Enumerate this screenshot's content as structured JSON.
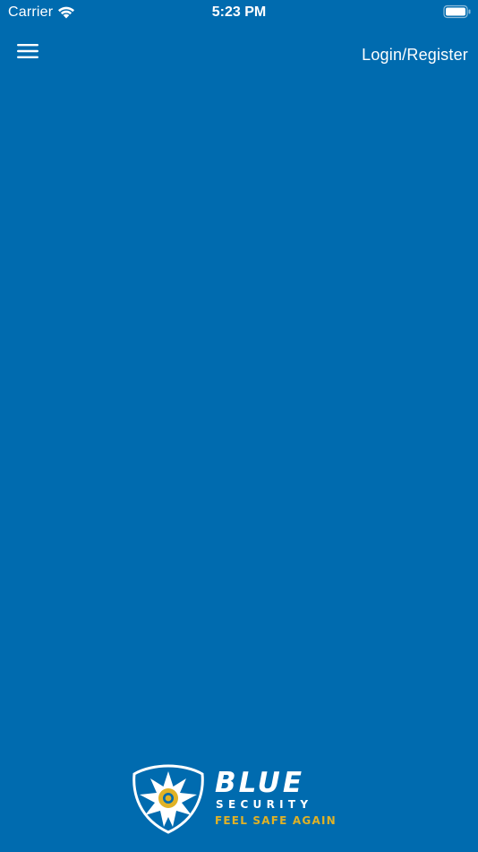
{
  "status_bar": {
    "carrier": "Carrier",
    "time": "5:23 PM",
    "wifi_icon": "wifi-icon",
    "battery_icon": "battery-icon"
  },
  "nav": {
    "menu_icon": "hamburger-menu-icon",
    "login_label": "Login/Register"
  },
  "logo": {
    "word": "BLUE",
    "sub": "SECURITY",
    "tagline": "FEEL SAFE AGAIN"
  },
  "colors": {
    "background": "#006baf",
    "text": "#ffffff",
    "accent_gold": "#e0b226"
  }
}
